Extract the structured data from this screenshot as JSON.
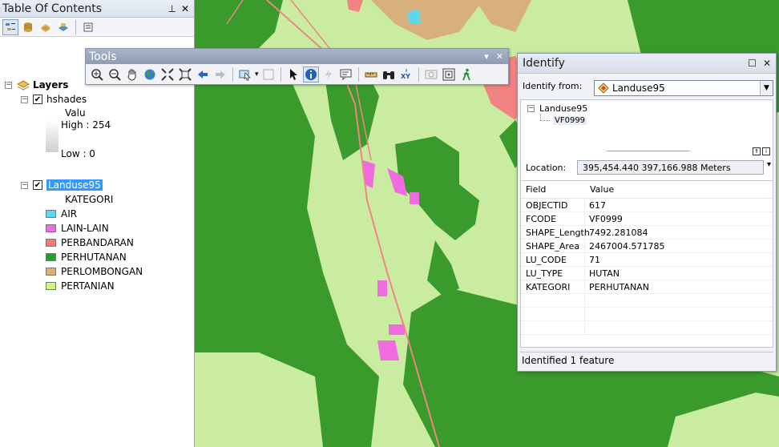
{
  "toc": {
    "title": "Table Of Contents",
    "pin": "⊥",
    "close": "✕",
    "layers_label": "Layers",
    "hshade": {
      "name": "hshades",
      "value_label": "Valu",
      "high": "High : 254",
      "low": "Low : 0"
    },
    "landuse": {
      "name": "Landuse95",
      "field": "KATEGORI",
      "classes": [
        {
          "label": "AIR",
          "color": "#5bd7ef"
        },
        {
          "label": "LAIN-LAIN",
          "color": "#f06ae0"
        },
        {
          "label": "PERBANDARAN",
          "color": "#f27a7a"
        },
        {
          "label": "PERHUTANAN",
          "color": "#2e9a2a"
        },
        {
          "label": "PERLOMBONGAN",
          "color": "#d9b07a"
        },
        {
          "label": "PERTANIAN",
          "color": "#ccf58a"
        }
      ]
    }
  },
  "tools": {
    "title": "Tools",
    "menu": "▾",
    "close": "✕"
  },
  "identify": {
    "title": "Identify",
    "identify_from_label": "Identify from:",
    "identify_from_value": "Landuse95",
    "tree_layer": "Landuse95",
    "tree_feature": "VF0999",
    "location_label": "Location:",
    "location_value": "395,454.440  397,166.988 Meters",
    "col_field": "Field",
    "col_value": "Value",
    "rows": [
      {
        "field": "OBJECTID",
        "value": "617"
      },
      {
        "field": "FCODE",
        "value": "VF0999"
      },
      {
        "field": "SHAPE_Length",
        "value": "7492.281084"
      },
      {
        "field": "SHAPE_Area",
        "value": "2467004.571785"
      },
      {
        "field": "LU_CODE",
        "value": "71"
      },
      {
        "field": "LU_TYPE",
        "value": "HUTAN"
      },
      {
        "field": "KATEGORI",
        "value": "PERHUTANAN"
      }
    ],
    "status": "Identified 1 feature"
  }
}
